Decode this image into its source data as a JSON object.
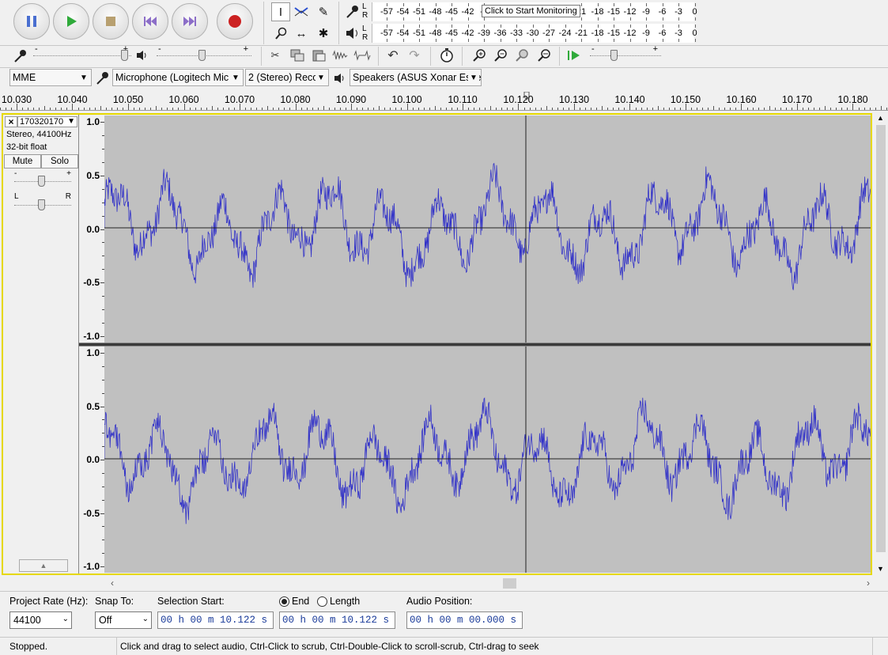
{
  "transport": {
    "pause_label": "Pause",
    "play_label": "Play",
    "stop_label": "Stop",
    "skip_start_label": "Skip to Start",
    "skip_end_label": "Skip to End",
    "record_label": "Record"
  },
  "meters": {
    "record_ticks": [
      "-57",
      "-54",
      "-51",
      "-48",
      "-45",
      "-42",
      "-3"
    ],
    "record_ticks_after": [
      "21",
      "-18",
      "-15",
      "-12",
      "-9",
      "-6",
      "-3",
      "0"
    ],
    "tooltip": "Click to Start Monitoring",
    "play_ticks": [
      "-57",
      "-54",
      "-51",
      "-48",
      "-45",
      "-42",
      "-39",
      "-36",
      "-33",
      "-30",
      "-27",
      "-24",
      "-21",
      "-18",
      "-15",
      "-12",
      "-9",
      "-6",
      "-3",
      "0"
    ],
    "lr_record": "L\nR",
    "lr_play": "L\nR"
  },
  "slider_marks": {
    "minus": "-",
    "plus": "+"
  },
  "device_toolbar": {
    "host": "MME",
    "recording_device": "Microphone (Logitech Mic",
    "channels": "2 (Stereo) Recor",
    "playback_device": "Speakers (ASUS Xonar Essen"
  },
  "timeline": {
    "labels": [
      "10.030",
      "10.040",
      "10.050",
      "10.060",
      "10.070",
      "10.080",
      "10.090",
      "10.100",
      "10.110",
      "10.120",
      "10.130",
      "10.140",
      "10.150",
      "10.160",
      "10.170",
      "10.180"
    ]
  },
  "track": {
    "name": "170320170",
    "info_line1": "Stereo, 44100Hz",
    "info_line2": "32-bit float",
    "mute_label": "Mute",
    "solo_label": "Solo",
    "pan_left": "L",
    "pan_right": "R",
    "gain_minus": "-",
    "gain_plus": "+",
    "close_label": "×",
    "menu_arrow": "▼",
    "collapse_arrow": "▲",
    "scale_labels": [
      "1.0",
      "0.5",
      "0.0",
      "-0.5",
      "-1.0"
    ]
  },
  "selection_bar": {
    "project_rate_label": "Project Rate (Hz):",
    "project_rate": "44100",
    "snap_to_label": "Snap To:",
    "snap_to": "Off",
    "selection_start_label": "Selection Start:",
    "end_label": "End",
    "length_label": "Length",
    "selection_start": "00 h 00 m 10.122 s",
    "selection_end": "00 h 00 m 10.122 s",
    "audio_position_label": "Audio Position:",
    "audio_position": "00 h 00 m 00.000 s"
  },
  "status": {
    "state": "Stopped.",
    "hint": "Click and drag to select audio, Ctrl-Click to scrub, Ctrl-Double-Click to scroll-scrub, Ctrl-drag to seek"
  },
  "colors": {
    "waveform": "#3232c8",
    "background": "#c0c0c0",
    "selected_border": "#e6d800"
  }
}
